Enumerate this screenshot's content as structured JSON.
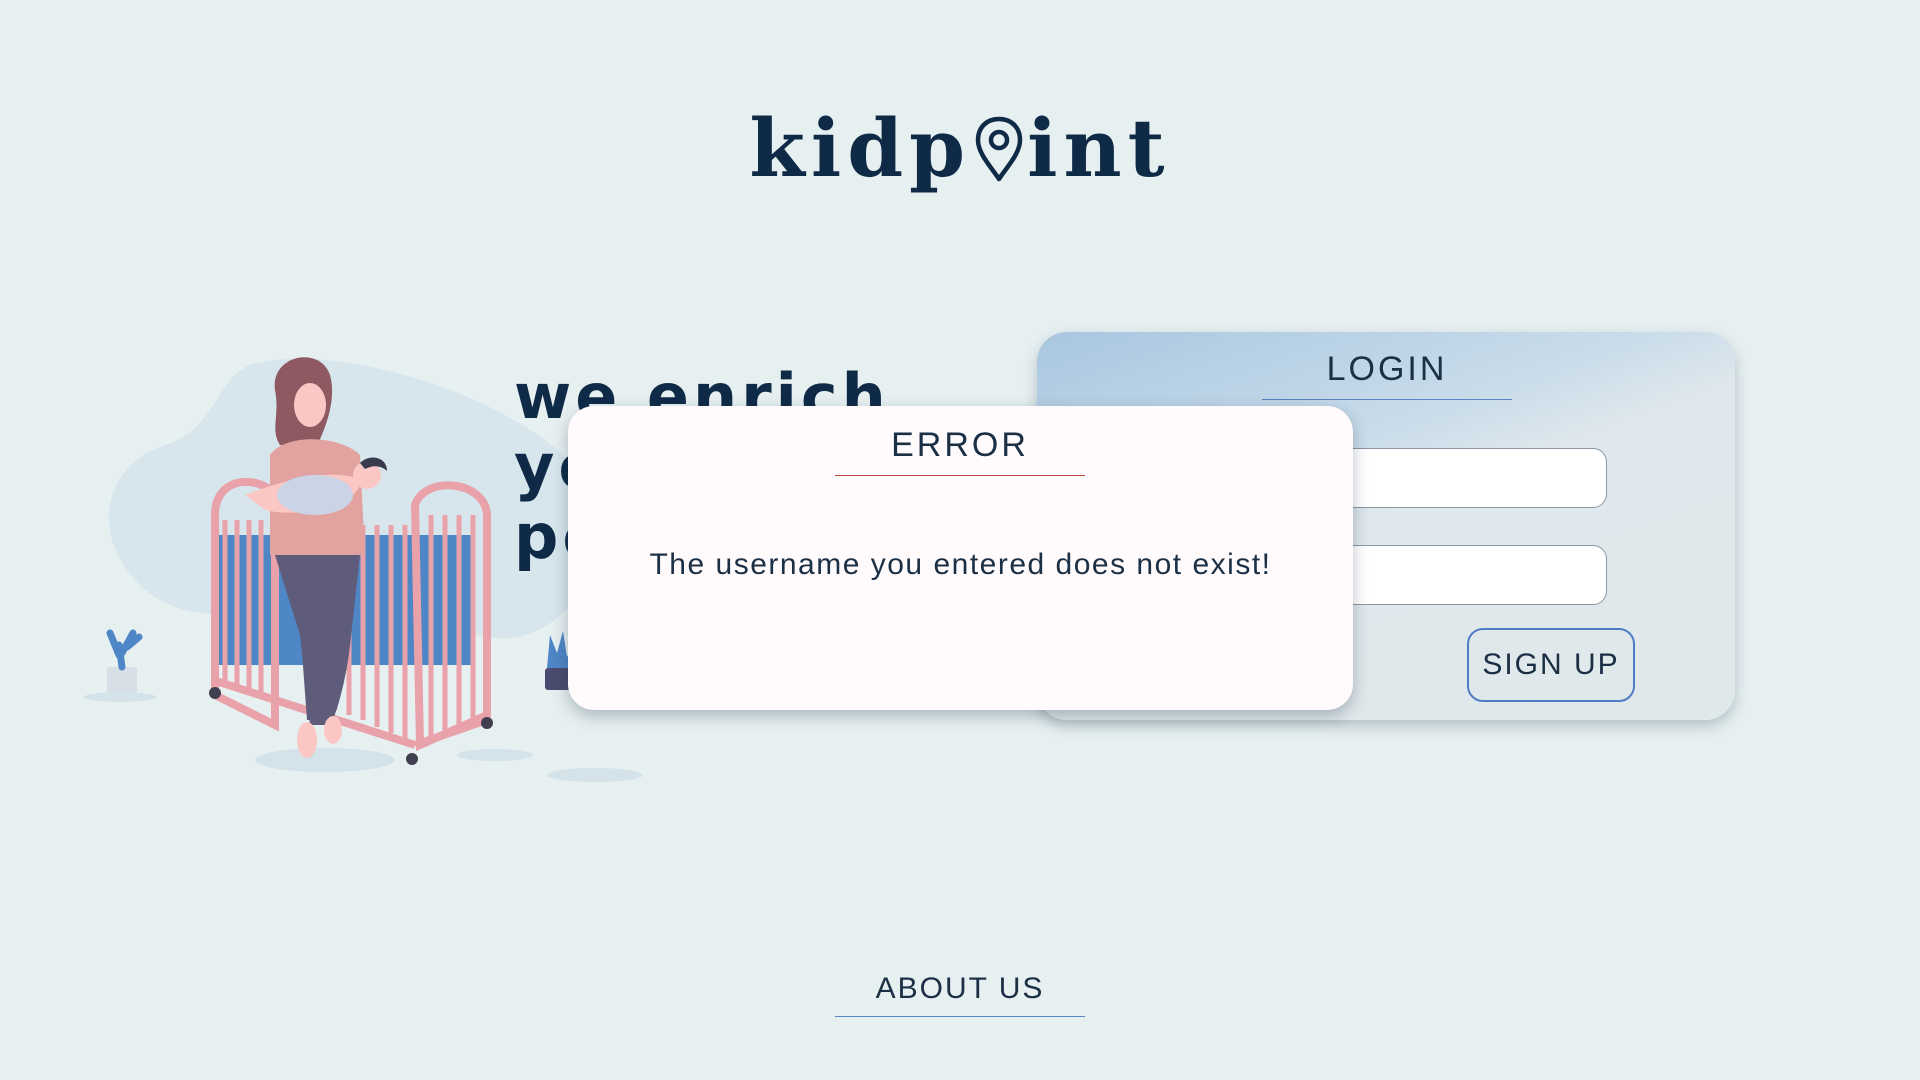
{
  "brand": {
    "logo_before_pin": "kidp",
    "logo_after_pin": "int",
    "logo_pin_icon": "map-pin-icon",
    "color": "#0f2a47"
  },
  "hero": {
    "tagline_lines": [
      "we enrich",
      "yo",
      "po"
    ],
    "illustration_icon": "mother-with-baby-at-crib-illustration"
  },
  "login": {
    "title": "LOGIN",
    "username_value": "",
    "password_value": "",
    "signup_label": "SIGN UP",
    "accent_color": "#5b84c4"
  },
  "error_dialog": {
    "title": "ERROR",
    "message": "The username you entered does not exist!",
    "accent_color": "#c0463f"
  },
  "footer": {
    "about_label": "ABOUT US"
  }
}
